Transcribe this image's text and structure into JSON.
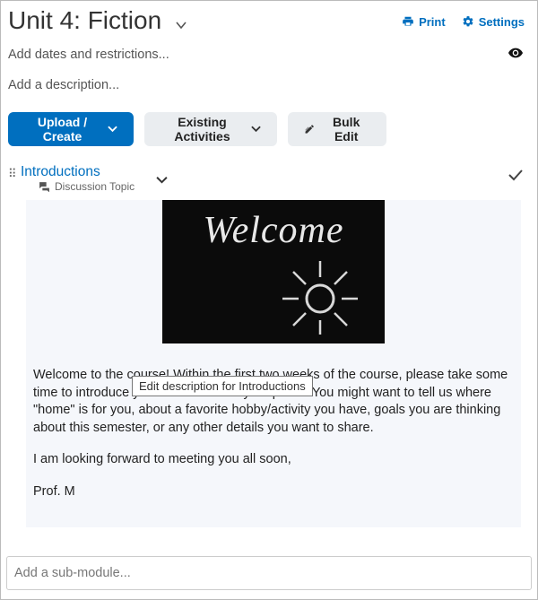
{
  "header": {
    "title": "Unit 4: Fiction",
    "print": "Print",
    "settings": "Settings"
  },
  "meta": {
    "dates_restrictions": "Add dates and restrictions...",
    "add_description": "Add a description..."
  },
  "buttons": {
    "upload_create": "Upload / Create",
    "existing_activities": "Existing Activities",
    "bulk_edit": "Bulk Edit"
  },
  "item": {
    "title": "Introductions",
    "type_label": "Discussion Topic",
    "image_text": "Welcome",
    "paragraph1": "Welcome to the course! Within the first two weeks of the course, please take some time to introduce yourself to me and your peers. You might want to tell us where \"home\" is for you, about a favorite hobby/activity you have, goals you are thinking about this semester, or any other details you want to share.",
    "paragraph2": "I am looking forward to meeting you all soon,",
    "signature": "Prof. M"
  },
  "tooltip": "Edit description for Introductions",
  "submodule_placeholder": "Add a sub-module..."
}
